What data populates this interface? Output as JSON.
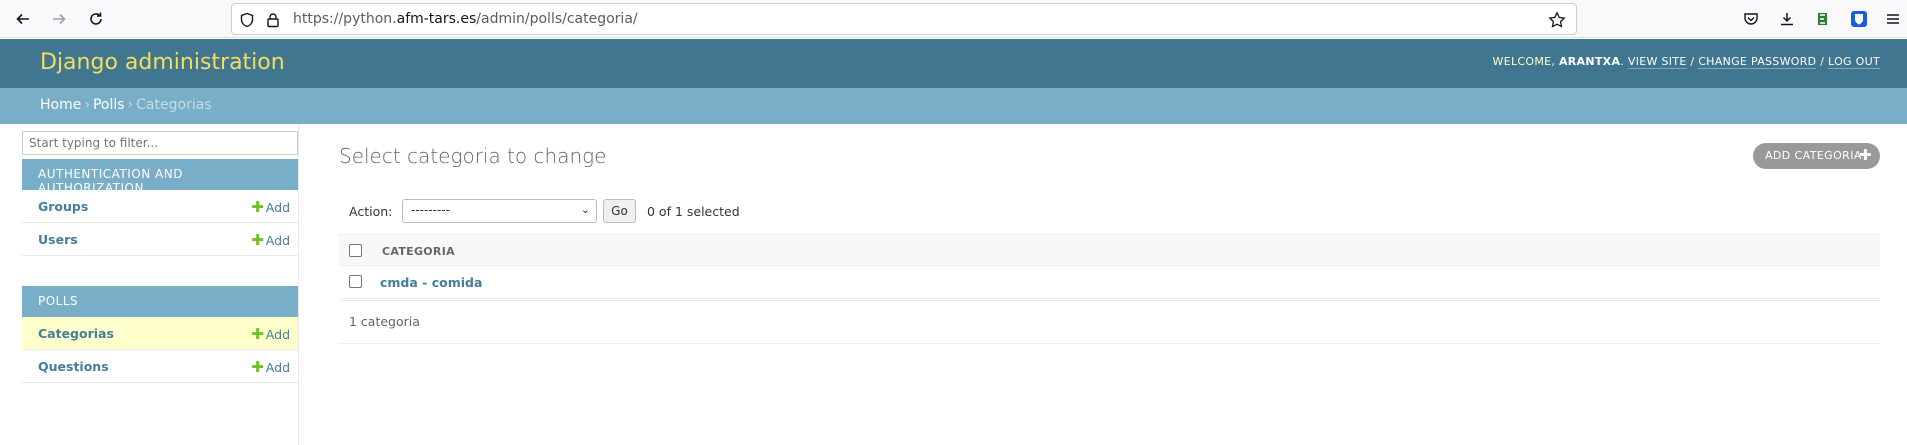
{
  "browser": {
    "url_prefix": "https://python.",
    "url_domain": "afm-tars.es",
    "url_path": "/admin/polls/categoria/"
  },
  "header": {
    "branding": "Django administration",
    "welcome": "Welcome,",
    "username": "Arantxa",
    "view_site": "View site",
    "change_password": "Change password",
    "log_out": "Log out",
    "separator": "/"
  },
  "breadcrumbs": {
    "home": "Home",
    "app": "Polls",
    "current": "Categorias",
    "sep": "›"
  },
  "sidebar": {
    "filter_placeholder": "Start typing to filter...",
    "modules": [
      {
        "caption": "Authentication and Authorization",
        "models": [
          {
            "name": "Groups",
            "add": "Add"
          },
          {
            "name": "Users",
            "add": "Add"
          }
        ]
      },
      {
        "caption": "Polls",
        "models": [
          {
            "name": "Categorias",
            "add": "Add"
          },
          {
            "name": "Questions",
            "add": "Add"
          }
        ]
      }
    ]
  },
  "main": {
    "title": "Select categoria to change",
    "add_button": "Add categoria",
    "action_label": "Action:",
    "action_selected": "---------",
    "go": "Go",
    "selected_count": "0 of 1 selected",
    "column_header": "Categoria",
    "rows": [
      "cmda - comida"
    ],
    "paginator": "1 categoria"
  },
  "colors": {
    "header_bg": "#417690",
    "breadcrumbs_bg": "#79aec8",
    "branding": "#f5dd5d",
    "link": "#447e9b",
    "add_plus": "#70bf2b",
    "current_row": "#ffffcc"
  }
}
